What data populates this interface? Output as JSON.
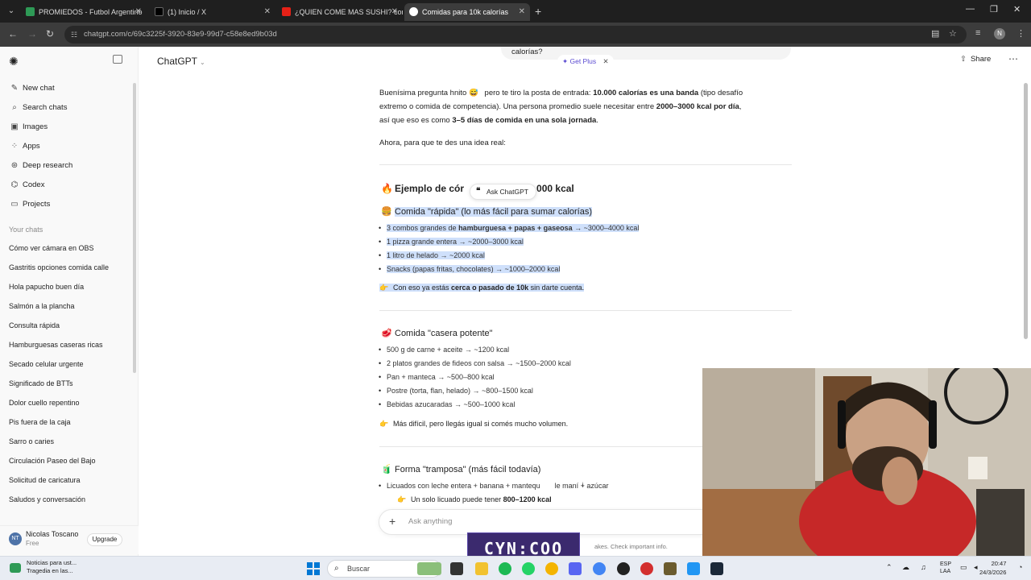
{
  "browser": {
    "tabs": [
      {
        "label": "PROMIEDOS - Futbol Argentino",
        "favicon_color": "#2e9a56"
      },
      {
        "label": "(1) Inicio / X",
        "favicon_color": "#000000"
      },
      {
        "label": "¿QUIEN COME MAS SUSHI? con",
        "favicon_color": "#e62117"
      },
      {
        "label": "Comidas para 10k calorías",
        "favicon_color": "#ffffff"
      }
    ],
    "url": "chatgpt.com/c/69c3225f-3920-83e9-99d7-c58e8ed9b03d",
    "profile_initial": "N"
  },
  "sidebar": {
    "nav": [
      {
        "label": "New chat",
        "icon": "edit-icon"
      },
      {
        "label": "Search chats",
        "icon": "search-icon"
      },
      {
        "label": "Images",
        "icon": "image-icon"
      },
      {
        "label": "Apps",
        "icon": "apps-icon"
      },
      {
        "label": "Deep research",
        "icon": "research-icon"
      },
      {
        "label": "Codex",
        "icon": "code-icon"
      },
      {
        "label": "Projects",
        "icon": "folder-icon"
      }
    ],
    "section_label": "Your chats",
    "chats": [
      "Cómo ver cámara en OBS",
      "Gastritis opciones comida calle",
      "Hola papucho buen día",
      "Salmón a la plancha",
      "Consulta rápida",
      "Hamburguesas caseras ricas",
      "Secado celular urgente",
      "Significado de BTTs",
      "Dolor cuello repentino",
      "Pis fuera de la caja",
      "Sarro o caries",
      "Circulación Paseo del Bajo",
      "Solicitud de caricatura",
      "Saludos y conversación"
    ],
    "user": {
      "initials": "NT",
      "name": "Nicolas Toscano",
      "plan": "Free",
      "upgrade_label": "Upgrade"
    }
  },
  "header": {
    "model": "ChatGPT",
    "share_label": "Share",
    "prev_message_tail": "calorías?",
    "get_plus_label": "Get Plus"
  },
  "message": {
    "intro_1a": "Buenísima pregunta hnito ",
    "intro_1b": " pero te tiro la posta de entrada: ",
    "intro_1c": "10.000 calorías es una banda",
    "intro_1d": " (tipo desafío",
    "intro_2a": "extremo o comida de competencia). Una persona promedio suele necesitar entre ",
    "intro_2b": "2000–3000 kcal por día",
    "intro_2c": ",",
    "intro_3a": "así que eso es como ",
    "intro_3b": "3–5 días de comida en una sola jornada",
    "intro_3c": ".",
    "intro_4": "Ahora, para que te des una idea real:",
    "heading_a": "Ejemplo de cór",
    "heading_b": "0.000 kcal",
    "ask_chatgpt": "Ask ChatGPT",
    "section1_title": "Comida \"rápida\" (lo más fácil para sumar calorías)",
    "section1_items": [
      {
        "a": "3 combos grandes de ",
        "b": "hamburguesa + papas + gaseosa",
        "c": " → ~3000–4000 kcal"
      },
      {
        "a": "1 pizza grande entera → ~2000–3000 kcal",
        "b": "",
        "c": ""
      },
      {
        "a": "1 litro de helado → ~2000 kcal",
        "b": "",
        "c": ""
      },
      {
        "a": "Snacks (papas fritas, chocolates) → ~1000–2000 kcal",
        "b": "",
        "c": ""
      }
    ],
    "section1_note_a": "Con eso ya estás ",
    "section1_note_b": "cerca o pasado de 10k",
    "section1_note_c": " sin darte cuenta.",
    "section2_title": "Comida \"casera potente\"",
    "section2_items": [
      "500 g de carne + aceite → ~1200 kcal",
      "2 platos grandes de fideos con salsa → ~1500–2000 kcal",
      "Pan + manteca → ~500–800 kcal",
      "Postre (torta, flan, helado) → ~800–1500 kcal",
      "Bebidas azucaradas → ~500–1000 kcal"
    ],
    "section2_note": "Más difícil, pero llegás igual si comés mucho volumen.",
    "section3_title": "Forma \"tramposa\" (más fácil todavía)",
    "section3_item_a": "Licuados con leche entera + banana + mantequ",
    "section3_item_b": "le maní + azúcar",
    "section3_sub_a": "Un solo licuado puede tener ",
    "section3_sub_b": "800–1200 kcal"
  },
  "composer": {
    "placeholder": "Ask anything",
    "disclaimer": "akes. Check important info."
  },
  "overlay": {
    "logo_text": "CYN:COO"
  },
  "taskbar": {
    "weather_line1": "Noticias para ust...",
    "weather_line2": "Tragedia en las...",
    "search_label": "Buscar",
    "lang_1": "ESP",
    "lang_2": "LAA",
    "time": "20:47",
    "date": "24/3/2026"
  }
}
